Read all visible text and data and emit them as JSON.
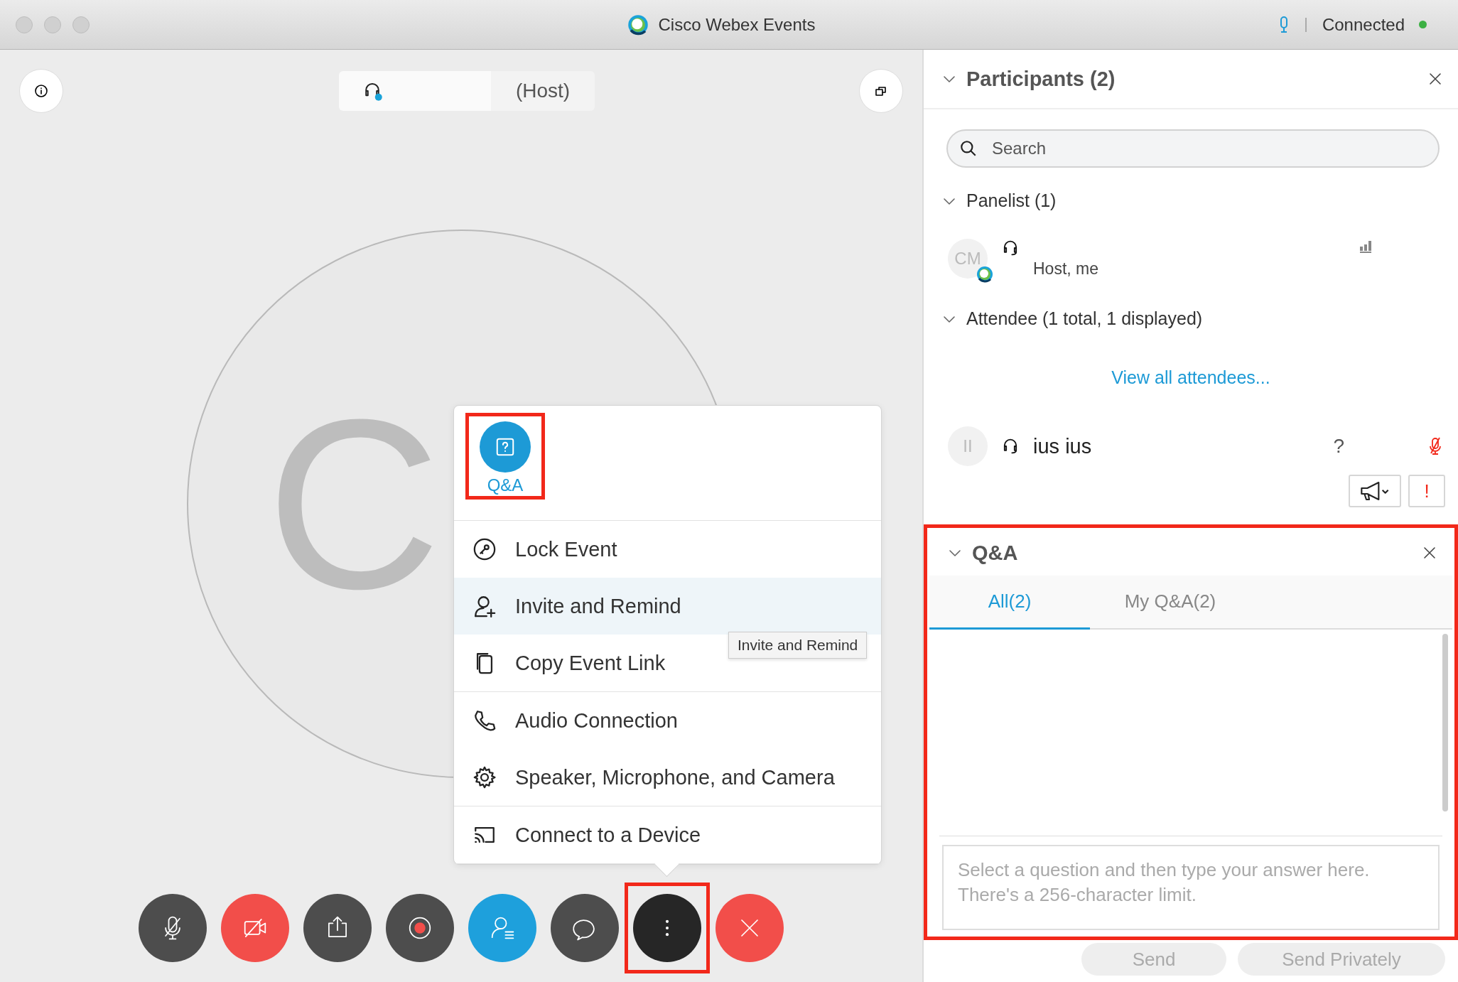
{
  "window": {
    "title": "Cisco Webex Events",
    "status": "Connected",
    "connected": true
  },
  "stage": {
    "host_label": "(Host)",
    "avatar_initial": "C"
  },
  "more_menu": {
    "quick_actions": [
      {
        "kind": "qa",
        "label": "Q&A",
        "highlighted": true
      }
    ],
    "groups": [
      [
        {
          "kind": "lock",
          "label": "Lock Event",
          "hovered": false
        },
        {
          "kind": "invite",
          "label": "Invite and Remind",
          "hovered": true
        },
        {
          "kind": "copy",
          "label": "Copy Event Link",
          "hovered": false
        }
      ],
      [
        {
          "kind": "phone",
          "label": "Audio Connection",
          "hovered": false
        },
        {
          "kind": "gear",
          "label": "Speaker, Microphone, and Camera",
          "hovered": false
        }
      ],
      [
        {
          "kind": "cast",
          "label": "Connect to a Device",
          "hovered": false
        }
      ]
    ],
    "tooltip": "Invite and Remind"
  },
  "toolbar": [
    {
      "kind": "mic-off",
      "active": false,
      "highlighted": false
    },
    {
      "kind": "video-off",
      "active": false,
      "highlighted": false
    },
    {
      "kind": "share",
      "active": false,
      "highlighted": false
    },
    {
      "kind": "record",
      "active": false,
      "highlighted": false
    },
    {
      "kind": "participants",
      "active": true,
      "highlighted": false
    },
    {
      "kind": "chat",
      "active": false,
      "highlighted": false
    },
    {
      "kind": "more",
      "active": true,
      "highlighted": true
    },
    {
      "kind": "leave",
      "active": false,
      "highlighted": false
    }
  ],
  "participants": {
    "title": "Participants (2)",
    "expanded": true,
    "search": {
      "placeholder": "Search"
    },
    "panelists": {
      "label": "Panelist (1)",
      "expanded": true,
      "members": [
        {
          "initials": "CM",
          "role": "Host, me"
        }
      ]
    },
    "attendees": {
      "label": "Attendee (1 total, 1 displayed)",
      "expanded": true,
      "link": "View all attendees...",
      "members": [
        {
          "initials": "II",
          "name": "ius ius",
          "hand": "?",
          "muted": true
        }
      ]
    },
    "alert_button": "!"
  },
  "qa": {
    "title": "Q&A",
    "expanded": true,
    "highlighted": true,
    "tabs": [
      {
        "label": "All(2)",
        "selected": true
      },
      {
        "label": "My Q&A(2)",
        "selected": false
      }
    ],
    "answer": {
      "placeholder": "Select a question and then type your answer here. There's a 256-character limit."
    },
    "buttons": [
      {
        "label": "Send",
        "disabled": true
      },
      {
        "label": "Send Privately",
        "disabled": true
      }
    ]
  }
}
